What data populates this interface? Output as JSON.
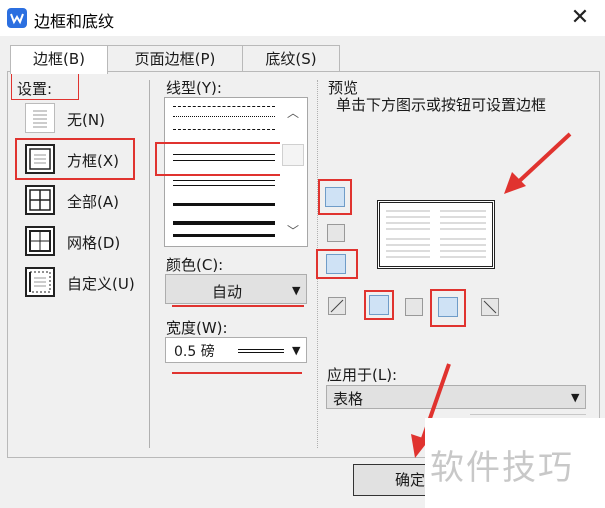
{
  "window": {
    "title": "边框和底纹"
  },
  "tabs": {
    "borders": "边框(B)",
    "page_borders": "页面边框(P)",
    "shading": "底纹(S)"
  },
  "setting": {
    "label": "设置:",
    "options": [
      {
        "label": "无(N)",
        "icon": "setting-none-icon"
      },
      {
        "label": "方框(X)",
        "icon": "setting-box-icon",
        "selected": true
      },
      {
        "label": "全部(A)",
        "icon": "setting-all-icon"
      },
      {
        "label": "网格(D)",
        "icon": "setting-grid-icon"
      },
      {
        "label": "自定义(U)",
        "icon": "setting-custom-icon"
      }
    ]
  },
  "style": {
    "label": "线型(Y):",
    "selected": "double-line"
  },
  "color": {
    "label": "颜色(C):",
    "value": "自动"
  },
  "width": {
    "label": "宽度(W):",
    "value": "0.5 磅"
  },
  "preview": {
    "label": "预览",
    "hint": "单击下方图示或按钮可设置边框"
  },
  "apply_to": {
    "label": "应用于(L):",
    "value": "表格"
  },
  "buttons": {
    "ok": "确定"
  },
  "watermark": "软件技巧",
  "colors": {
    "highlight": "#e0332f",
    "accent": "#2b6fe0"
  }
}
